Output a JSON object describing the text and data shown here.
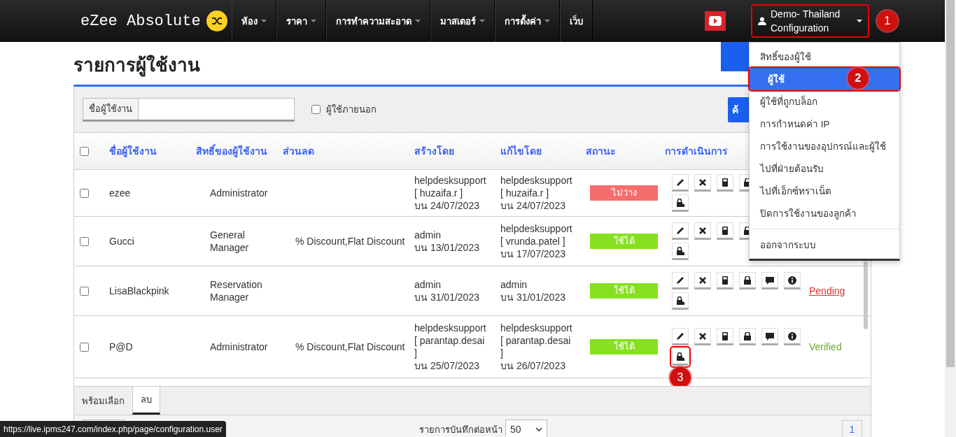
{
  "nav": {
    "logo": "eZee Absolute",
    "items": [
      {
        "label": "ห้อง",
        "has_menu": true
      },
      {
        "label": "ราคา",
        "has_menu": true
      },
      {
        "label": "การทำความสะอาด",
        "has_menu": true
      },
      {
        "label": "มาสเตอร์",
        "has_menu": true
      },
      {
        "label": "การตั้งค่า",
        "has_menu": true
      },
      {
        "label": "เว็บ",
        "has_menu": false
      }
    ],
    "user_line_1": "Demo- Thailand",
    "user_line_2": "Configuration"
  },
  "user_menu": [
    {
      "label": "สิทธิ์ของผู้ใช้",
      "selected": false
    },
    {
      "label": "ผู้ใช้",
      "selected": true
    },
    {
      "label": "ผู้ใช้ที่ถูกบล็อก",
      "selected": false
    },
    {
      "label": "การกำหนดค่า IP",
      "selected": false
    },
    {
      "label": "การใช้งานของอุปกรณ์และผู้ใช้",
      "selected": false
    },
    {
      "label": "ไปที่ฝ่ายต้อนรับ",
      "selected": false
    },
    {
      "label": "ไปที่เอ็กซ์ทราเน็ต",
      "selected": false
    },
    {
      "label": "ปิดการใช้งานของลูกค้า",
      "selected": false
    },
    {
      "label": "ออกจากระบบ",
      "selected": false,
      "divider_before": true
    }
  ],
  "markers": [
    "1",
    "2",
    "3"
  ],
  "page_title": "รายการผู้ใช้งาน",
  "filter": {
    "label": "ชื่อผู้ใช้งาน",
    "external_label": "ผู้ใช้ภายนอก",
    "external_checked": false,
    "search_button": "ค้"
  },
  "table": {
    "all_checked": false,
    "columns": [
      "ชื่อผู้ใช้งาน",
      "สิทธิ์ของผู้ใช้งาน",
      "ส่วนลด",
      "สร้างโดย",
      "แก้ไขโดย",
      "สถานะ",
      "การดำเนินการ"
    ],
    "rows": [
      {
        "checked": false,
        "name": "ezee",
        "role": "Administrator",
        "discount": "",
        "created": [
          "helpdesksupport",
          "[ huzaifa.r ]",
          "บน 24/07/2023"
        ],
        "modified": [
          "helpdesksupport",
          "[ huzaifa.r ]",
          "บน 24/07/2023"
        ],
        "status": {
          "label": "ไม่ว่าง",
          "color": "#f76c6c"
        },
        "actions": [
          {
            "kind": "edit",
            "highlighted": false
          },
          {
            "kind": "delete",
            "highlighted": false
          },
          {
            "kind": "calculator",
            "highlighted": false
          },
          {
            "kind": "lock",
            "highlighted": false
          },
          {
            "kind": "unlock",
            "highlighted": false
          }
        ]
      },
      {
        "checked": false,
        "name": "Gucci",
        "role": "General Manager",
        "discount": "% Discount,Flat Discount",
        "created": [
          "admin",
          "บน 13/01/2023"
        ],
        "modified": [
          "helpdesksupport",
          "[ vrunda.patel ]",
          "บน 17/07/2023"
        ],
        "status": {
          "label": "ใช้ได้",
          "color": "#86e01e"
        },
        "actions": [
          {
            "kind": "edit",
            "highlighted": false
          },
          {
            "kind": "delete",
            "highlighted": false
          },
          {
            "kind": "calculator",
            "highlighted": false
          },
          {
            "kind": "lock",
            "highlighted": false
          },
          {
            "kind": "unlock",
            "highlighted": false
          }
        ]
      },
      {
        "checked": false,
        "name": "LisaBlackpink",
        "role": "Reservation Manager",
        "discount": "",
        "created": [
          "admin",
          "บน 31/01/2023"
        ],
        "modified": [
          "admin",
          "บน 31/01/2023"
        ],
        "status": {
          "label": "ใช้ได้",
          "color": "#86e01e"
        },
        "actions": [
          {
            "kind": "edit",
            "highlighted": false
          },
          {
            "kind": "delete",
            "highlighted": false
          },
          {
            "kind": "calculator",
            "highlighted": false
          },
          {
            "kind": "lock",
            "highlighted": false
          },
          {
            "kind": "comment",
            "highlighted": false
          },
          {
            "kind": "info",
            "highlighted": false
          },
          {
            "kind": "unlock",
            "highlighted": false
          }
        ],
        "verify": {
          "label": "Pending",
          "kind": "link"
        }
      },
      {
        "checked": false,
        "name": "P@D",
        "role": "Administrator",
        "discount": "% Discount,Flat Discount",
        "created": [
          "helpdesksupport",
          "[ parantap.desai",
          "]",
          "บน 25/07/2023"
        ],
        "modified": [
          "helpdesksupport",
          "[ parantap.desai",
          "]",
          "บน 26/07/2023"
        ],
        "status": {
          "label": "ใช้ได้",
          "color": "#86e01e"
        },
        "actions": [
          {
            "kind": "edit",
            "highlighted": false
          },
          {
            "kind": "delete",
            "highlighted": false
          },
          {
            "kind": "calculator",
            "highlighted": false
          },
          {
            "kind": "lock",
            "highlighted": false
          },
          {
            "kind": "comment",
            "highlighted": false
          },
          {
            "kind": "info",
            "highlighted": false
          },
          {
            "kind": "unlock",
            "highlighted": true
          }
        ],
        "verify": {
          "label": "Verified",
          "kind": "ok"
        }
      }
    ]
  },
  "bottom_tabs": [
    {
      "label": "พร้อมเลือก",
      "selected": false
    },
    {
      "label": "ลบ",
      "selected": true
    }
  ],
  "pager": {
    "per_page_label": "รายการบันทึกต่อหน้า",
    "per_page": "50",
    "page": "1"
  },
  "status_url": "https://live.ipms247.com/index.php/page/configuration.user"
}
